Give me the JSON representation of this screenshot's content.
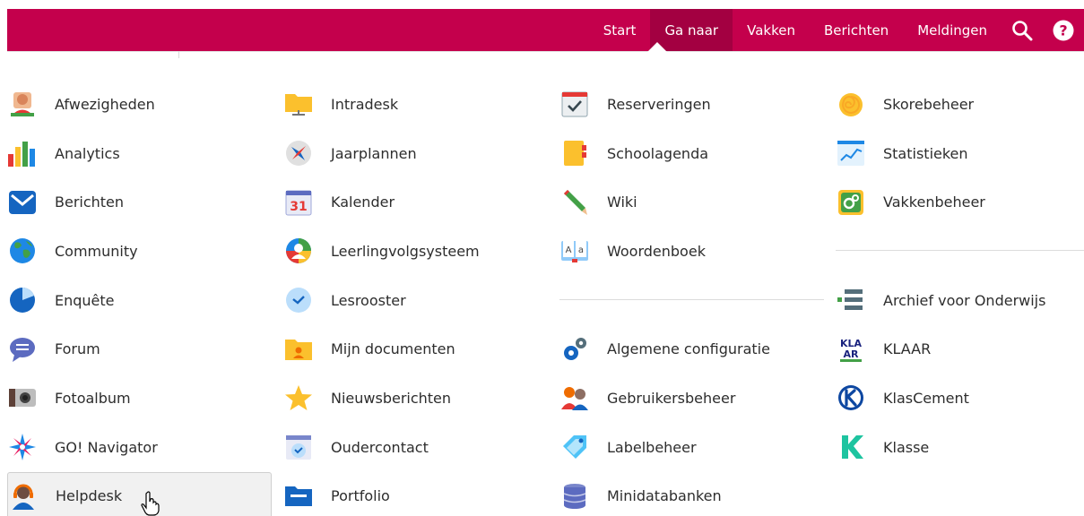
{
  "nav": {
    "items": [
      "Start",
      "Ga naar",
      "Vakken",
      "Berichten",
      "Meldingen"
    ],
    "active": "Ga naar",
    "brand_color": "#c4004c",
    "active_color": "#a30041",
    "search_icon": "search-icon",
    "help_icon": "help-icon"
  },
  "columns": [
    [
      {
        "label": "Afwezigheden",
        "icon": "person-red-icon"
      },
      {
        "label": "Analytics",
        "icon": "bar-chart-icon"
      },
      {
        "label": "Berichten",
        "icon": "envelope-icon"
      },
      {
        "label": "Community",
        "icon": "globe-icon"
      },
      {
        "label": "Enquête",
        "icon": "pie-chart-icon"
      },
      {
        "label": "Forum",
        "icon": "speech-bubble-icon"
      },
      {
        "label": "Fotoalbum",
        "icon": "camera-icon"
      },
      {
        "label": "GO! Navigator",
        "icon": "compass-star-icon"
      },
      {
        "label": "Helpdesk",
        "icon": "headset-icon",
        "hover": true
      }
    ],
    [
      {
        "label": "Intradesk",
        "icon": "folder-network-icon"
      },
      {
        "label": "Jaarplannen",
        "icon": "compass-icon"
      },
      {
        "label": "Kalender",
        "icon": "calendar-31-icon",
        "icon_text": "31"
      },
      {
        "label": "Leerlingvolgsysteem",
        "icon": "student-tracking-icon"
      },
      {
        "label": "Lesrooster",
        "icon": "clock-icon"
      },
      {
        "label": "Mijn documenten",
        "icon": "folder-user-icon"
      },
      {
        "label": "Nieuwsberichten",
        "icon": "star-icon"
      },
      {
        "label": "Oudercontact",
        "icon": "calendar-clock-icon"
      },
      {
        "label": "Portfolio",
        "icon": "portfolio-folder-icon"
      }
    ],
    [
      {
        "label": "Reserveringen",
        "icon": "calendar-check-icon"
      },
      {
        "label": "Schoolagenda",
        "icon": "agenda-icon"
      },
      {
        "label": "Wiki",
        "icon": "pencil-icon"
      },
      {
        "label": "Woordenboek",
        "icon": "dictionary-icon",
        "icon_text": "A a"
      },
      {
        "separator": true
      },
      {
        "label": "Algemene configuratie",
        "icon": "gears-icon"
      },
      {
        "label": "Gebruikersbeheer",
        "icon": "users-icon"
      },
      {
        "label": "Labelbeheer",
        "icon": "tags-icon"
      },
      {
        "label": "Minidatabanken",
        "icon": "database-icon"
      }
    ],
    [
      {
        "label": "Skorebeheer",
        "icon": "spiral-shell-icon"
      },
      {
        "label": "Statistieken",
        "icon": "line-chart-icon"
      },
      {
        "label": "Vakkenbeheer",
        "icon": "puzzle-settings-icon"
      },
      {
        "separator": true
      },
      {
        "label": "Archief voor Onderwijs",
        "icon": "archive-icon"
      },
      {
        "label": "KLAAR",
        "icon": "klaar-logo-icon",
        "icon_text": "KLA AR"
      },
      {
        "label": "KlasCement",
        "icon": "klascement-logo-icon"
      },
      {
        "label": "Klasse",
        "icon": "klasse-logo-icon"
      }
    ]
  ]
}
